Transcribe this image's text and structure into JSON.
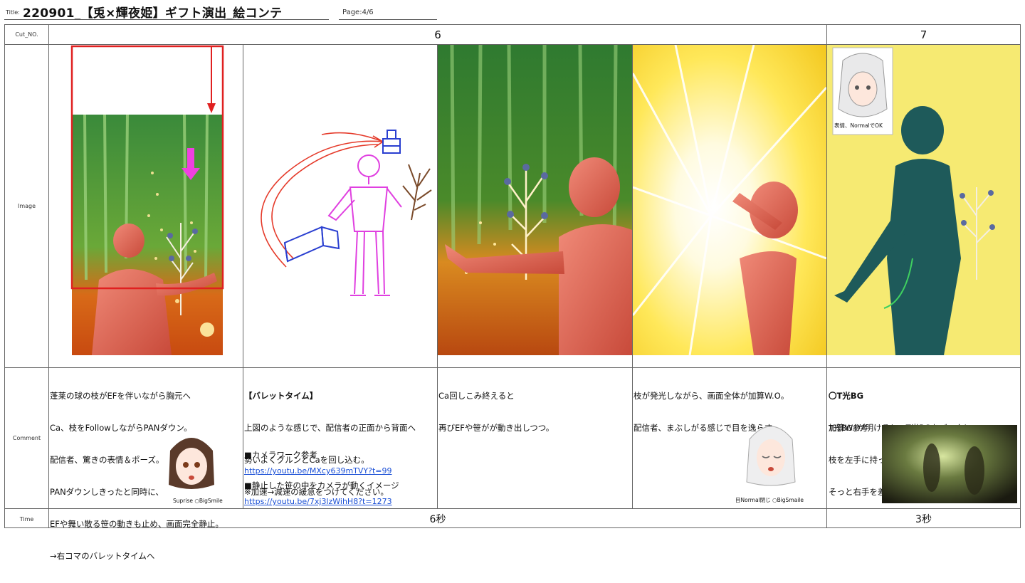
{
  "header": {
    "title_label": "Title:",
    "title": "220901_【兎×輝夜姫】ギフト演出_絵コンテ",
    "page": "Page:4/6"
  },
  "rows": {
    "cut": "Cut_NO.",
    "image": "Image",
    "comment": "Comment",
    "time": "Time"
  },
  "cuts": [
    {
      "number": "6",
      "time": "6秒"
    },
    {
      "number": "7",
      "time": "3秒"
    }
  ],
  "comments": {
    "c1": {
      "lines": [
        "蓬莱の球の枝がEFを伴いながら胸元へ",
        "Ca、枝をFollowしながらPANダウン。",
        "配信者、驚きの表情＆ポーズ。",
        "PANダウンしきったと同時に、",
        "EFや舞い散る笹の動きも止め、画面完全静止。",
        "→右コマのバレットタイムへ"
      ],
      "face_label": "Suprise ○BigSmile"
    },
    "c2": {
      "heading": "【バレットタイム】",
      "lines": [
        "上図のような感じで、配信者の正面から背面へ",
        "勢いよくグルンとCaを回し込む。",
        "※加速→減速の緩急をつけてください。"
      ],
      "ref1_label": "■カメラワーク参考",
      "ref1_url": "https://youtu.be/MXcy639mTVY?t=99",
      "ref2_label": "■静止した笹の中をカメラが動くイメージ",
      "ref2_url": "https://youtu.be/7xj3lzWihH8?t=1273"
    },
    "c3": {
      "lines": [
        "Ca回しこみ終えると",
        "再びEFや笹がが動き出しつつ。"
      ]
    },
    "c4": {
      "lines": [
        "枝が発光しながら、画面全体が加算W.O。",
        "配信者、まぶしがる感じで目を逸らす。"
      ],
      "face_label": "目Normal閉じ ○BigSmaile"
    },
    "c5": {
      "heading": "〇T光BG",
      "lines": [
        "加算W.Iが明けると、T光BGをバックに",
        "枝を左手に持った視聴者が立っている。",
        "そっと右手を差し出す視聴者。Ca、FIX。"
      ],
      "ref_label": "T光BG参考"
    }
  },
  "panel5_note": "表情、NormalでOK",
  "colors": {
    "grid": "#666666",
    "link": "#1a4fd6",
    "red": "#e02020",
    "magenta": "#e040e0",
    "blue": "#2a3fd0"
  }
}
